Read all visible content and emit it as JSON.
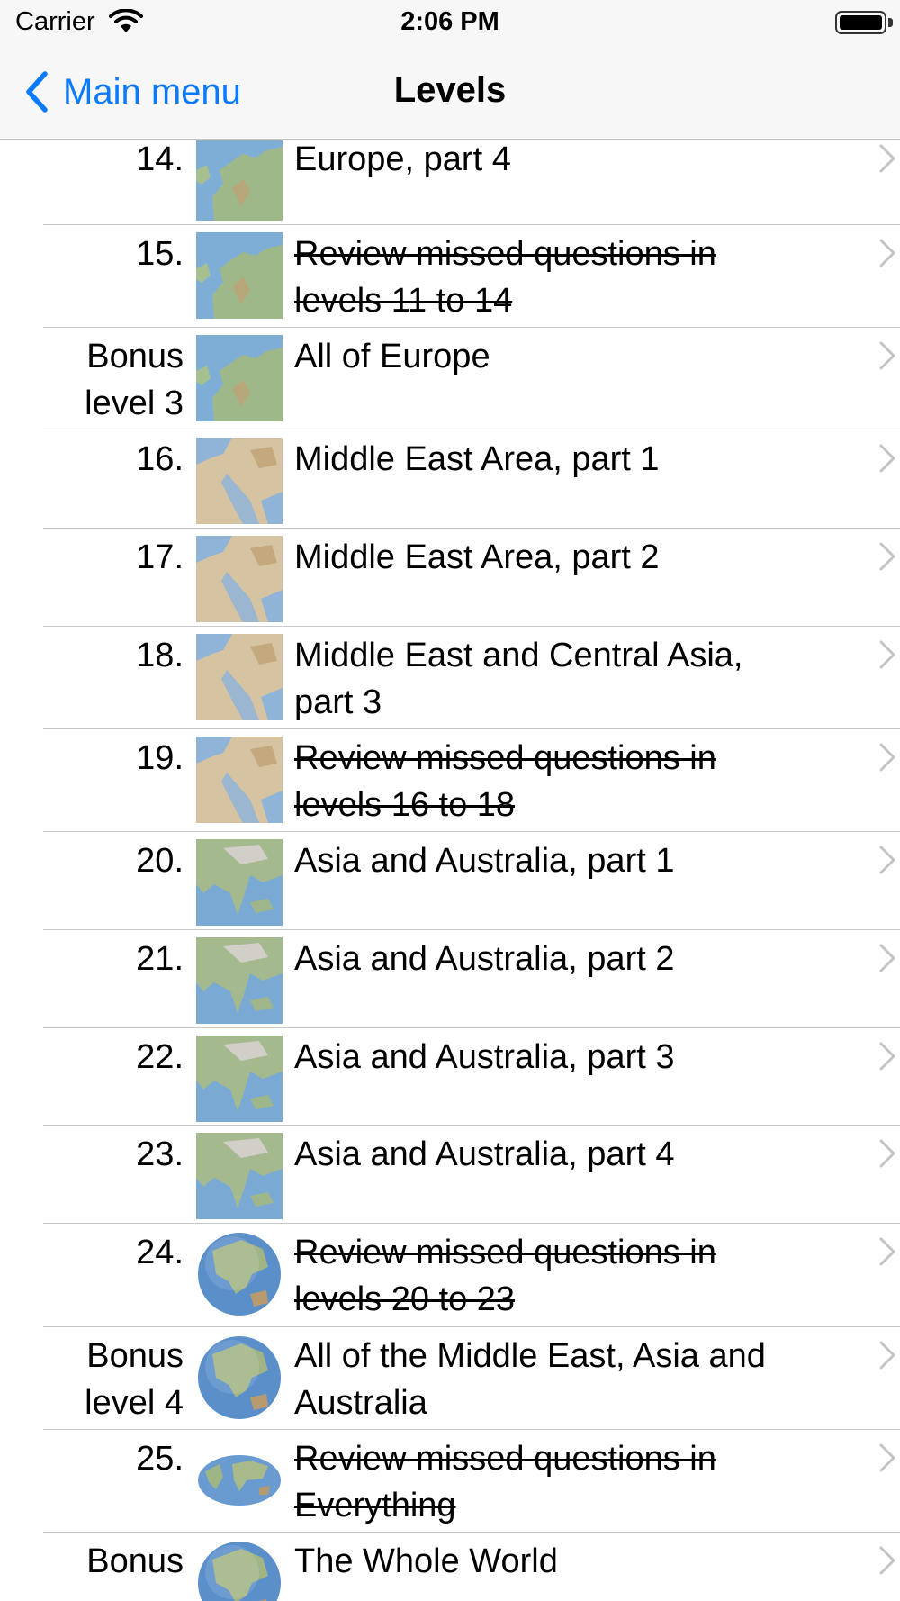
{
  "status_bar": {
    "carrier": "Carrier",
    "time": "2:06 PM"
  },
  "nav": {
    "back_label": "Main menu",
    "title": "Levels"
  },
  "colors": {
    "accent": "#0a7aff",
    "separator": "#c8c7cc",
    "chevron": "#c4c4c7"
  },
  "levels": [
    {
      "num": "14.",
      "title": "Europe, part 4",
      "done": false,
      "thumb": "map-europe-icon"
    },
    {
      "num": "15.",
      "title": "Review missed questions in levels 11 to 14",
      "done": true,
      "thumb": "map-europe-icon"
    },
    {
      "num": "Bonus level 3",
      "title": "All of Europe",
      "done": false,
      "thumb": "map-europe-icon"
    },
    {
      "num": "16.",
      "title": "Middle East Area, part 1",
      "done": false,
      "thumb": "map-middle-east-icon"
    },
    {
      "num": "17.",
      "title": "Middle East Area, part 2",
      "done": false,
      "thumb": "map-middle-east-icon"
    },
    {
      "num": "18.",
      "title": "Middle East and Central Asia, part 3",
      "done": false,
      "thumb": "map-middle-east-icon"
    },
    {
      "num": "19.",
      "title": "Review missed questions in levels 16 to 18",
      "done": true,
      "thumb": "map-middle-east-icon"
    },
    {
      "num": "20.",
      "title": "Asia and Australia, part 1",
      "done": false,
      "thumb": "map-asia-icon"
    },
    {
      "num": "21.",
      "title": "Asia and Australia, part 2",
      "done": false,
      "thumb": "map-asia-icon"
    },
    {
      "num": "22.",
      "title": "Asia and Australia, part 3",
      "done": false,
      "thumb": "map-asia-icon"
    },
    {
      "num": "23.",
      "title": "Asia and Australia, part 4",
      "done": false,
      "thumb": "map-asia-icon"
    },
    {
      "num": "24.",
      "title": "Review missed questions in levels 20 to 23",
      "done": true,
      "thumb": "globe-icon"
    },
    {
      "num": "Bonus level 4",
      "title": "All of the Middle East, Asia and Australia",
      "done": false,
      "thumb": "globe-icon"
    },
    {
      "num": "25.",
      "title": "Review missed questions in Everything",
      "done": true,
      "thumb": "world-map-icon"
    },
    {
      "num": "Bonus",
      "title": "The Whole World",
      "done": false,
      "thumb": "globe-icon"
    }
  ]
}
